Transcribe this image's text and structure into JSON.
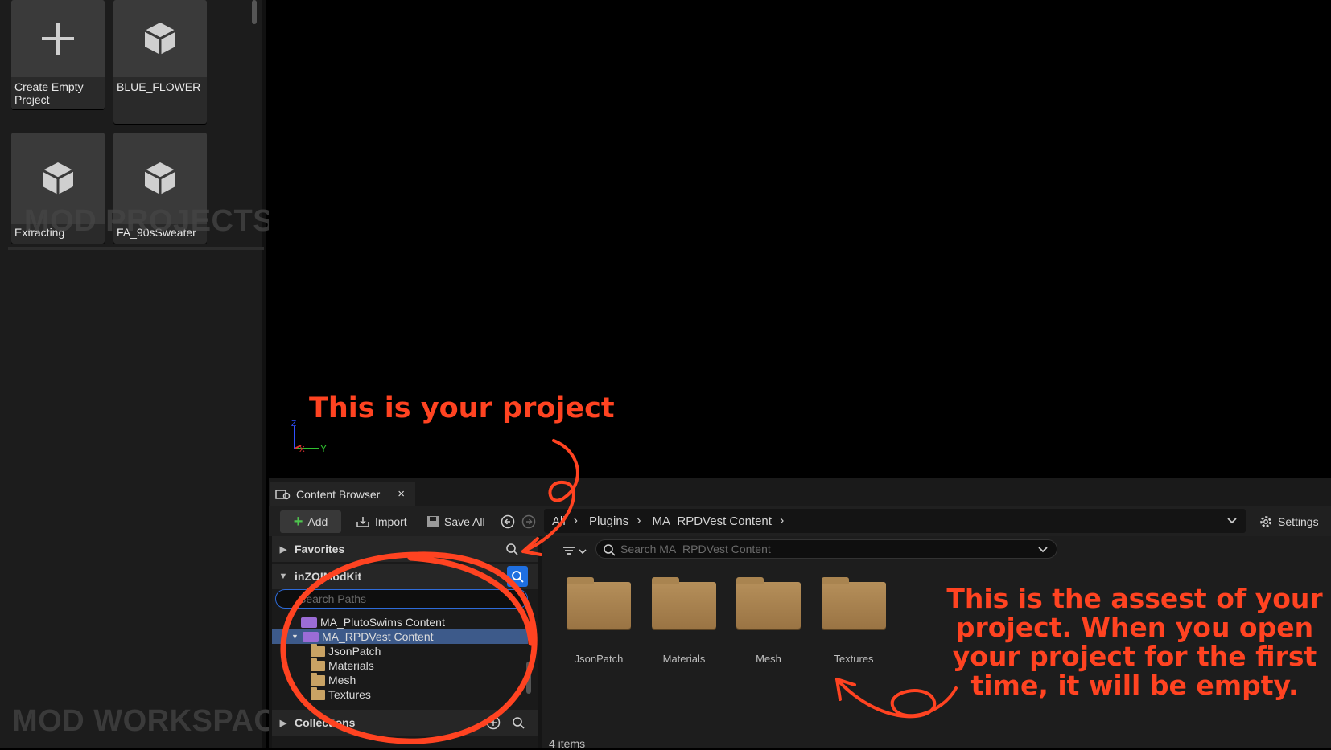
{
  "project_tiles": [
    {
      "label": "Create Empty Project",
      "icon": "plus-icon"
    },
    {
      "label": "BLUE_FLOWER",
      "icon": "cube-icon"
    },
    {
      "label": "Extracting",
      "icon": "cube-icon"
    },
    {
      "label": "FA_90sSweater",
      "icon": "cube-icon"
    }
  ],
  "watermarks": {
    "projects": "MOD PROJECTS",
    "workspace": "MOD WORKSPAC"
  },
  "viewport": {
    "axis_z": "Z",
    "axis_y": "Y",
    "axis_x": "X"
  },
  "content_browser": {
    "tab_label": "Content Browser",
    "tab_close": "×",
    "toolbar": {
      "add": "Add",
      "import": "Import",
      "save_all": "Save All",
      "settings": "Settings"
    },
    "breadcrumb": [
      "All",
      "Plugins",
      "MA_RPDVest Content"
    ],
    "sources": {
      "favorites": "Favorites",
      "project_root": "inZOIModKit",
      "search_paths_placeholder": "Search Paths",
      "collections": "Collections",
      "tree": [
        {
          "label": "MA_PlutoSwims Content",
          "type": "plugin"
        },
        {
          "label": "MA_RPDVest Content",
          "type": "plugin",
          "selected": true
        },
        {
          "label": "JsonPatch",
          "type": "folder"
        },
        {
          "label": "Materials",
          "type": "folder"
        },
        {
          "label": "Mesh",
          "type": "folder"
        },
        {
          "label": "Textures",
          "type": "folder"
        }
      ]
    },
    "asset_search_placeholder": "Search MA_RPDVest Content",
    "assets": [
      "JsonPatch",
      "Materials",
      "Mesh",
      "Textures"
    ],
    "item_count": "4 items"
  },
  "annotations": {
    "project": "This is your project",
    "assets": "This is the assest of your project. When you open your project for the first time, it will be empty."
  },
  "colors": {
    "annotation": "#ff4321",
    "selection": "#3d5a8a",
    "accent_blue": "#1f6fe0"
  }
}
